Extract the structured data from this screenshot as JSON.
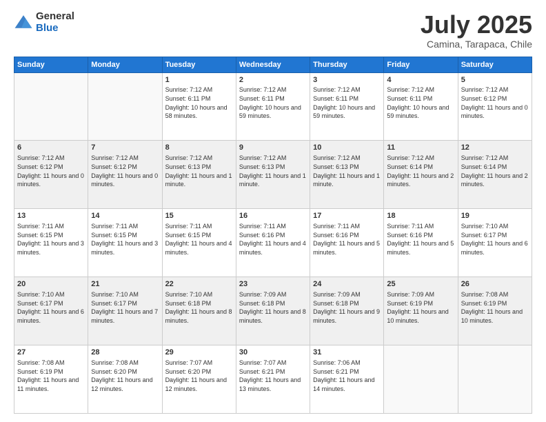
{
  "logo": {
    "general": "General",
    "blue": "Blue"
  },
  "header": {
    "title": "July 2025",
    "subtitle": "Camina, Tarapaca, Chile"
  },
  "weekdays": [
    "Sunday",
    "Monday",
    "Tuesday",
    "Wednesday",
    "Thursday",
    "Friday",
    "Saturday"
  ],
  "weeks": [
    [
      {
        "day": "",
        "info": ""
      },
      {
        "day": "",
        "info": ""
      },
      {
        "day": "1",
        "info": "Sunrise: 7:12 AM\nSunset: 6:11 PM\nDaylight: 10 hours and 58 minutes."
      },
      {
        "day": "2",
        "info": "Sunrise: 7:12 AM\nSunset: 6:11 PM\nDaylight: 10 hours and 59 minutes."
      },
      {
        "day": "3",
        "info": "Sunrise: 7:12 AM\nSunset: 6:11 PM\nDaylight: 10 hours and 59 minutes."
      },
      {
        "day": "4",
        "info": "Sunrise: 7:12 AM\nSunset: 6:11 PM\nDaylight: 10 hours and 59 minutes."
      },
      {
        "day": "5",
        "info": "Sunrise: 7:12 AM\nSunset: 6:12 PM\nDaylight: 11 hours and 0 minutes."
      }
    ],
    [
      {
        "day": "6",
        "info": "Sunrise: 7:12 AM\nSunset: 6:12 PM\nDaylight: 11 hours and 0 minutes."
      },
      {
        "day": "7",
        "info": "Sunrise: 7:12 AM\nSunset: 6:12 PM\nDaylight: 11 hours and 0 minutes."
      },
      {
        "day": "8",
        "info": "Sunrise: 7:12 AM\nSunset: 6:13 PM\nDaylight: 11 hours and 1 minute."
      },
      {
        "day": "9",
        "info": "Sunrise: 7:12 AM\nSunset: 6:13 PM\nDaylight: 11 hours and 1 minute."
      },
      {
        "day": "10",
        "info": "Sunrise: 7:12 AM\nSunset: 6:13 PM\nDaylight: 11 hours and 1 minute."
      },
      {
        "day": "11",
        "info": "Sunrise: 7:12 AM\nSunset: 6:14 PM\nDaylight: 11 hours and 2 minutes."
      },
      {
        "day": "12",
        "info": "Sunrise: 7:12 AM\nSunset: 6:14 PM\nDaylight: 11 hours and 2 minutes."
      }
    ],
    [
      {
        "day": "13",
        "info": "Sunrise: 7:11 AM\nSunset: 6:15 PM\nDaylight: 11 hours and 3 minutes."
      },
      {
        "day": "14",
        "info": "Sunrise: 7:11 AM\nSunset: 6:15 PM\nDaylight: 11 hours and 3 minutes."
      },
      {
        "day": "15",
        "info": "Sunrise: 7:11 AM\nSunset: 6:15 PM\nDaylight: 11 hours and 4 minutes."
      },
      {
        "day": "16",
        "info": "Sunrise: 7:11 AM\nSunset: 6:16 PM\nDaylight: 11 hours and 4 minutes."
      },
      {
        "day": "17",
        "info": "Sunrise: 7:11 AM\nSunset: 6:16 PM\nDaylight: 11 hours and 5 minutes."
      },
      {
        "day": "18",
        "info": "Sunrise: 7:11 AM\nSunset: 6:16 PM\nDaylight: 11 hours and 5 minutes."
      },
      {
        "day": "19",
        "info": "Sunrise: 7:10 AM\nSunset: 6:17 PM\nDaylight: 11 hours and 6 minutes."
      }
    ],
    [
      {
        "day": "20",
        "info": "Sunrise: 7:10 AM\nSunset: 6:17 PM\nDaylight: 11 hours and 6 minutes."
      },
      {
        "day": "21",
        "info": "Sunrise: 7:10 AM\nSunset: 6:17 PM\nDaylight: 11 hours and 7 minutes."
      },
      {
        "day": "22",
        "info": "Sunrise: 7:10 AM\nSunset: 6:18 PM\nDaylight: 11 hours and 8 minutes."
      },
      {
        "day": "23",
        "info": "Sunrise: 7:09 AM\nSunset: 6:18 PM\nDaylight: 11 hours and 8 minutes."
      },
      {
        "day": "24",
        "info": "Sunrise: 7:09 AM\nSunset: 6:18 PM\nDaylight: 11 hours and 9 minutes."
      },
      {
        "day": "25",
        "info": "Sunrise: 7:09 AM\nSunset: 6:19 PM\nDaylight: 11 hours and 10 minutes."
      },
      {
        "day": "26",
        "info": "Sunrise: 7:08 AM\nSunset: 6:19 PM\nDaylight: 11 hours and 10 minutes."
      }
    ],
    [
      {
        "day": "27",
        "info": "Sunrise: 7:08 AM\nSunset: 6:19 PM\nDaylight: 11 hours and 11 minutes."
      },
      {
        "day": "28",
        "info": "Sunrise: 7:08 AM\nSunset: 6:20 PM\nDaylight: 11 hours and 12 minutes."
      },
      {
        "day": "29",
        "info": "Sunrise: 7:07 AM\nSunset: 6:20 PM\nDaylight: 11 hours and 12 minutes."
      },
      {
        "day": "30",
        "info": "Sunrise: 7:07 AM\nSunset: 6:21 PM\nDaylight: 11 hours and 13 minutes."
      },
      {
        "day": "31",
        "info": "Sunrise: 7:06 AM\nSunset: 6:21 PM\nDaylight: 11 hours and 14 minutes."
      },
      {
        "day": "",
        "info": ""
      },
      {
        "day": "",
        "info": ""
      }
    ]
  ]
}
